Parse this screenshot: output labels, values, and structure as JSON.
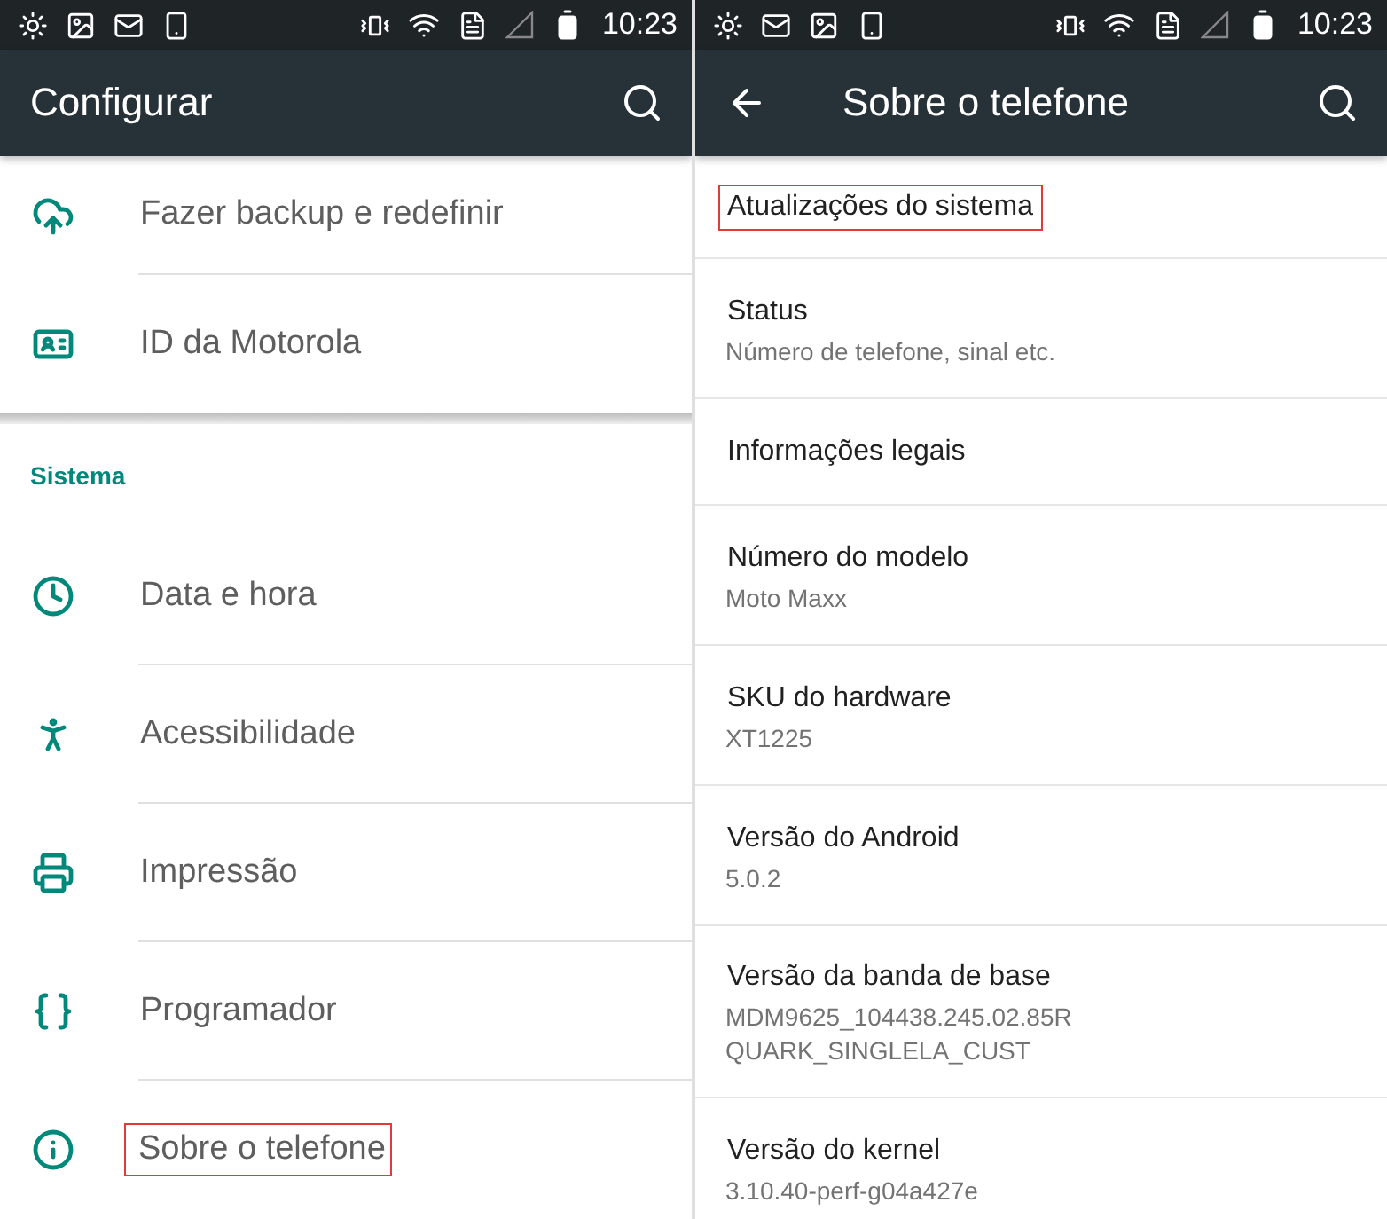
{
  "panels": [
    {
      "status_bar": {
        "time": "10:23"
      },
      "toolbar": {
        "title": "Configurar",
        "back": false
      },
      "groups": [
        {
          "items": [
            {
              "label": "Fazer backup e redefinir",
              "highlighted": false
            },
            {
              "label": "ID da Motorola",
              "highlighted": false
            }
          ]
        },
        {
          "header": "Sistema",
          "items": [
            {
              "label": "Data e hora",
              "highlighted": false
            },
            {
              "label": "Acessibilidade",
              "highlighted": false
            },
            {
              "label": "Impressão",
              "highlighted": false
            },
            {
              "label": "Programador",
              "highlighted": false
            },
            {
              "label": "Sobre o telefone",
              "highlighted": true
            }
          ]
        }
      ]
    },
    {
      "status_bar": {
        "time": "10:23"
      },
      "toolbar": {
        "title": "Sobre o telefone",
        "back": true
      },
      "rows": [
        {
          "title": "Atualizações do sistema",
          "highlighted": true
        },
        {
          "title": "Status",
          "highlighted": false,
          "lines": [
            "Número de telefone, sinal etc."
          ]
        },
        {
          "title": "Informações legais",
          "highlighted": false
        },
        {
          "title": "Número do modelo",
          "highlighted": false,
          "lines": [
            "Moto Maxx"
          ]
        },
        {
          "title": "SKU do hardware",
          "highlighted": false,
          "lines": [
            "XT1225"
          ]
        },
        {
          "title": "Versão do Android",
          "highlighted": false,
          "lines": [
            "5.0.2"
          ]
        },
        {
          "title": "Versão da banda de base",
          "highlighted": false,
          "lines": [
            "MDM9625_104438.245.02.85R",
            "QUARK_SINGLELA_CUST"
          ]
        },
        {
          "title": "Versão do kernel",
          "highlighted": false,
          "lines": [
            "3.10.40-perf-g04a427e"
          ]
        }
      ]
    }
  ]
}
